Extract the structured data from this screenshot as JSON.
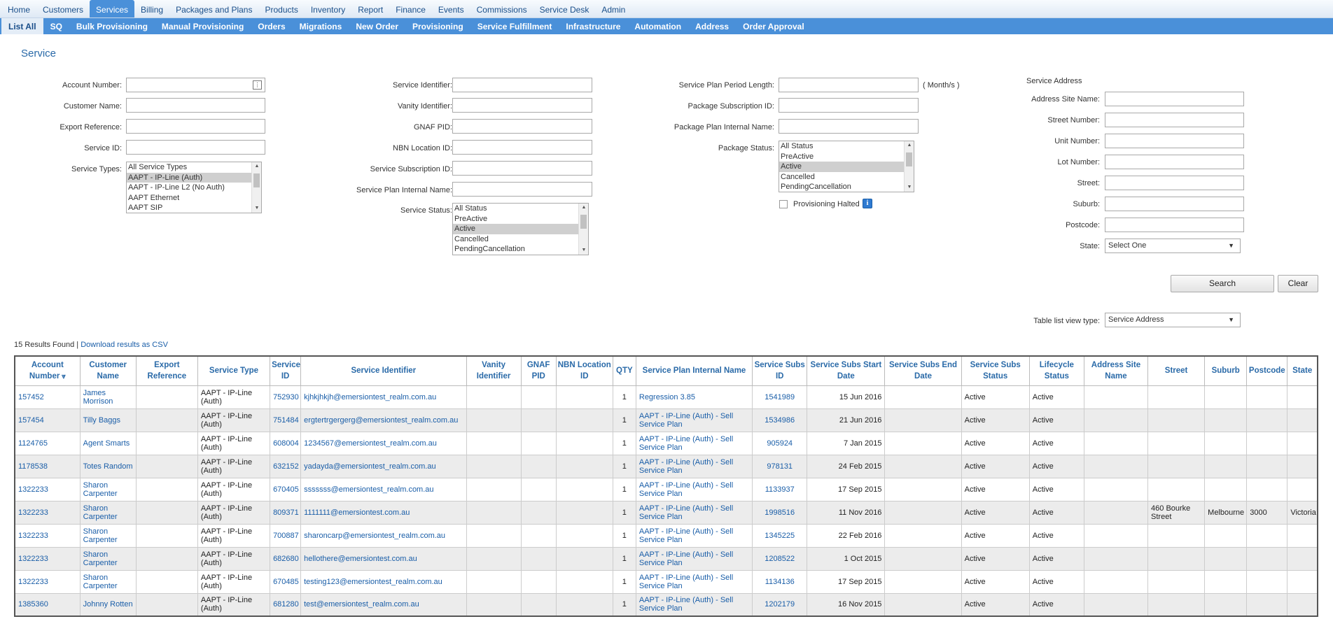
{
  "nav": {
    "items": [
      "Home",
      "Customers",
      "Services",
      "Billing",
      "Packages and Plans",
      "Products",
      "Inventory",
      "Report",
      "Finance",
      "Events",
      "Commissions",
      "Service Desk",
      "Admin"
    ],
    "active": "Services"
  },
  "subnav": {
    "items": [
      "List All",
      "SQ",
      "Bulk Provisioning",
      "Manual Provisioning",
      "Orders",
      "Migrations",
      "New Order",
      "Provisioning",
      "Service Fulfillment",
      "Infrastructure",
      "Automation",
      "Address",
      "Order Approval"
    ],
    "active": "List All"
  },
  "page_title": "Service",
  "form": {
    "col1": {
      "account_number": "Account Number:",
      "customer_name": "Customer Name:",
      "export_reference": "Export Reference:",
      "service_id": "Service ID:",
      "service_types": "Service Types:",
      "service_type_options": [
        "All Service Types",
        "AAPT - IP-Line (Auth)",
        "AAPT - IP-Line L2 (No Auth)",
        "AAPT Ethernet",
        "AAPT SIP"
      ],
      "service_type_selected": "AAPT - IP-Line (Auth)"
    },
    "col2": {
      "service_identifier": "Service Identifier:",
      "vanity_identifier": "Vanity Identifier:",
      "gnaf_pid": "GNAF PID:",
      "nbn_location_id": "NBN Location ID:",
      "service_subscription_id": "Service Subscription ID:",
      "service_plan_internal_name": "Service Plan Internal Name:",
      "service_status": "Service Status:",
      "service_status_options": [
        "All Status",
        "PreActive",
        "Active",
        "Cancelled",
        "PendingCancellation"
      ],
      "service_status_selected": "Active"
    },
    "col3": {
      "service_plan_period_length": "Service Plan Period Length:",
      "period_unit": "( Month/s )",
      "package_subscription_id": "Package Subscription ID:",
      "package_plan_internal_name": "Package Plan Internal Name:",
      "package_status": "Package Status:",
      "package_status_options": [
        "All Status",
        "PreActive",
        "Active",
        "Cancelled",
        "PendingCancellation"
      ],
      "package_status_selected": "Active",
      "provisioning_halted": "Provisioning Halted"
    },
    "col4": {
      "heading": "Service Address",
      "address_site_name": "Address Site Name:",
      "street_number": "Street Number:",
      "unit_number": "Unit Number:",
      "lot_number": "Lot Number:",
      "street": "Street:",
      "suburb": "Suburb:",
      "postcode": "Postcode:",
      "state": "State:",
      "state_value": "Select One"
    },
    "search_label": "Search",
    "clear_label": "Clear",
    "table_view_label": "Table list view type:",
    "table_view_value": "Service Address"
  },
  "results": {
    "count_text": "15 Results Found",
    "separator": "|",
    "download_text": "Download results as CSV"
  },
  "table": {
    "headers": [
      "Account Number",
      "Customer Name",
      "Export Reference",
      "Service Type",
      "Service ID",
      "Service Identifier",
      "Vanity Identifier",
      "GNAF PID",
      "NBN Location ID",
      "QTY",
      "Service Plan Internal Name",
      "Service Subs ID",
      "Service Subs Start Date",
      "Service Subs End Date",
      "Service Subs Status",
      "Lifecycle Status",
      "Address Site Name",
      "Street",
      "Suburb",
      "Postcode",
      "State"
    ],
    "rows": [
      [
        "157452",
        "James Morrison",
        "",
        "AAPT - IP-Line (Auth)",
        "752930",
        "kjhkjhkjh@emersiontest_realm.com.au",
        "",
        "",
        "",
        "1",
        "Regression 3.85",
        "1541989",
        "15 Jun 2016",
        "",
        "Active",
        "Active",
        "",
        "",
        "",
        "",
        ""
      ],
      [
        "157454",
        "Tilly Baggs",
        "",
        "AAPT - IP-Line (Auth)",
        "751484",
        "ergtertrgergerg@emersiontest_realm.com.au",
        "",
        "",
        "",
        "1",
        "AAPT - IP-Line (Auth) - Sell Service Plan",
        "1534986",
        "21 Jun 2016",
        "",
        "Active",
        "Active",
        "",
        "",
        "",
        "",
        ""
      ],
      [
        "1124765",
        "Agent Smarts",
        "",
        "AAPT - IP-Line (Auth)",
        "608004",
        "1234567@emersiontest_realm.com.au",
        "",
        "",
        "",
        "1",
        "AAPT - IP-Line (Auth) - Sell Service Plan",
        "905924",
        "7 Jan 2015",
        "",
        "Active",
        "Active",
        "",
        "",
        "",
        "",
        ""
      ],
      [
        "1178538",
        "Totes Random",
        "",
        "AAPT - IP-Line (Auth)",
        "632152",
        "yadayda@emersiontest_realm.com.au",
        "",
        "",
        "",
        "1",
        "AAPT - IP-Line (Auth) - Sell Service Plan",
        "978131",
        "24 Feb 2015",
        "",
        "Active",
        "Active",
        "",
        "",
        "",
        "",
        ""
      ],
      [
        "1322233",
        "Sharon Carpenter",
        "",
        "AAPT - IP-Line (Auth)",
        "670405",
        "sssssss@emersiontest_realm.com.au",
        "",
        "",
        "",
        "1",
        "AAPT - IP-Line (Auth) - Sell Service Plan",
        "1133937",
        "17 Sep 2015",
        "",
        "Active",
        "Active",
        "",
        "",
        "",
        "",
        ""
      ],
      [
        "1322233",
        "Sharon Carpenter",
        "",
        "AAPT - IP-Line (Auth)",
        "809371",
        "1111111@emersiontest.com.au",
        "",
        "",
        "",
        "1",
        "AAPT - IP-Line (Auth) - Sell Service Plan",
        "1998516",
        "11 Nov 2016",
        "",
        "Active",
        "Active",
        "",
        "460 Bourke Street",
        "Melbourne",
        "3000",
        "Victoria"
      ],
      [
        "1322233",
        "Sharon Carpenter",
        "",
        "AAPT - IP-Line (Auth)",
        "700887",
        "sharoncarp@emersiontest_realm.com.au",
        "",
        "",
        "",
        "1",
        "AAPT - IP-Line (Auth) - Sell Service Plan",
        "1345225",
        "22 Feb 2016",
        "",
        "Active",
        "Active",
        "",
        "",
        "",
        "",
        ""
      ],
      [
        "1322233",
        "Sharon Carpenter",
        "",
        "AAPT - IP-Line (Auth)",
        "682680",
        "hellothere@emersiontest.com.au",
        "",
        "",
        "",
        "1",
        "AAPT - IP-Line (Auth) - Sell Service Plan",
        "1208522",
        "1 Oct 2015",
        "",
        "Active",
        "Active",
        "",
        "",
        "",
        "",
        ""
      ],
      [
        "1322233",
        "Sharon Carpenter",
        "",
        "AAPT - IP-Line (Auth)",
        "670485",
        "testing123@emersiontest_realm.com.au",
        "",
        "",
        "",
        "1",
        "AAPT - IP-Line (Auth) - Sell Service Plan",
        "1134136",
        "17 Sep 2015",
        "",
        "Active",
        "Active",
        "",
        "",
        "",
        "",
        ""
      ],
      [
        "1385360",
        "Johnny Rotten",
        "",
        "AAPT - IP-Line (Auth)",
        "681280",
        "test@emersiontest_realm.com.au",
        "",
        "",
        "",
        "1",
        "AAPT - IP-Line (Auth) - Sell Service Plan",
        "1202179",
        "16 Nov 2015",
        "",
        "Active",
        "Active",
        "",
        "",
        "",
        "",
        ""
      ]
    ]
  },
  "colors": {
    "nav_blue": "#4a90d9",
    "link_blue": "#1a5ea8",
    "header_blue": "#2a6aa8"
  }
}
